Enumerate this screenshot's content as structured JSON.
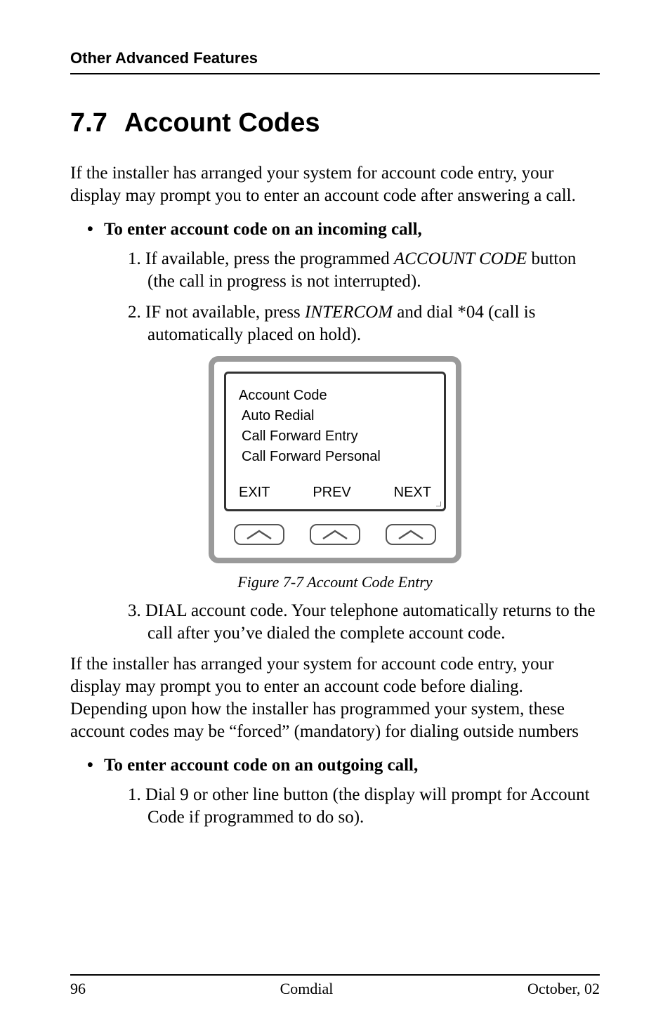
{
  "running_head": "Other Advanced Features",
  "section": {
    "number": "7.7",
    "title": "Account Codes"
  },
  "intro1": "If the installer has arranged your system for account code entry, your display may prompt you to enter an account code after answering a call.",
  "bullet1": "To enter account code on an incoming call,",
  "steps1": {
    "s1a": "1.  If available, press the programmed ",
    "s1b": "ACCOUNT CODE",
    "s1c": " button (the call in progress is not interrupted).",
    "s2a": "2.  IF not available, press ",
    "s2b": "INTERCOM",
    "s2c": " and dial  *04  (call is automatically placed on hold)."
  },
  "lcd": {
    "l1": "Account Code",
    "l2": "Auto Redial",
    "l3": "Call Forward Entry",
    "l4": "Call Forward Personal",
    "soft_left": "EXIT",
    "soft_mid": "PREV",
    "soft_right": "NEXT"
  },
  "figure_caption": "Figure 7-7  Account Code Entry",
  "step3": "3.  DIAL account code. Your telephone automatically returns to the call after you’ve dialed the complete account code.",
  "intro2": "If the installer has arranged your system for account code entry, your display may prompt you to enter an account code before dialing. Depending upon how the installer has programmed your system, these account codes may be “forced” (mandatory) for dialing outside numbers",
  "bullet2": "To enter account code on an outgoing call,",
  "steps2": {
    "s1": "1.  Dial  9 or other line button (the display will prompt for Account Code  if programmed to do so)."
  },
  "footer": {
    "page": "96",
    "center": "Comdial",
    "right": "October, 02"
  }
}
